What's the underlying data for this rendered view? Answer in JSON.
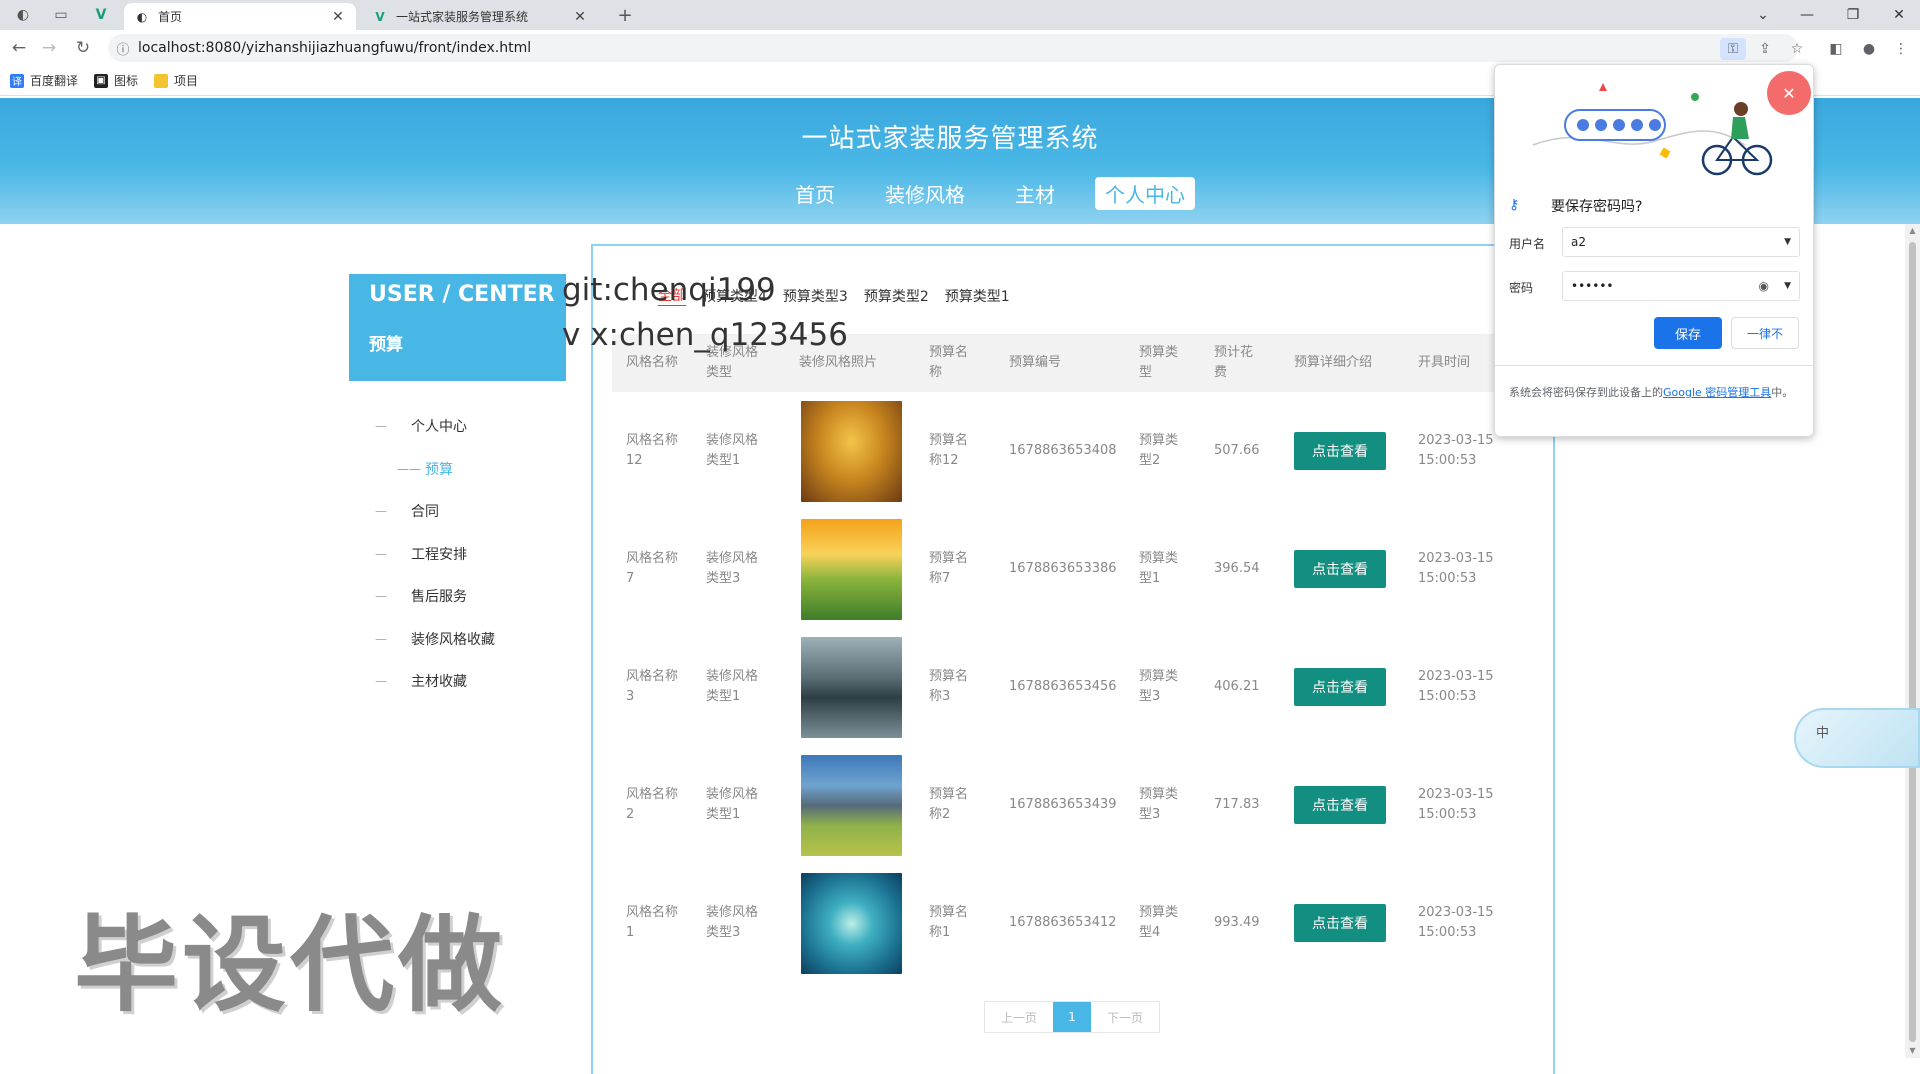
{
  "browser": {
    "tabs": [
      {
        "title": "首页",
        "active": true
      },
      {
        "title": "一站式家装服务管理系统",
        "active": false
      }
    ],
    "new_tab": "+",
    "url": "localhost:8080/yizhanshijiazhuangfuwu/front/index.html",
    "bookmarks": [
      "百度翻译",
      "图标",
      "项目"
    ]
  },
  "site": {
    "title": "一站式家装服务管理系统",
    "nav": [
      "首页",
      "装修风格",
      "主材",
      "个人中心"
    ],
    "nav_active": "个人中心"
  },
  "sidebar": {
    "header_title": "USER / CENTER",
    "header_sub": "预算",
    "items": [
      "个人中心",
      "预算",
      "合同",
      "工程安排",
      "售后服务",
      "装修风格收藏",
      "主材收藏"
    ],
    "active": "预算"
  },
  "filters": [
    "全部",
    "预算类型4",
    "预算类型3",
    "预算类型2",
    "预算类型1"
  ],
  "table": {
    "headers": [
      "风格名称",
      "装修风格类型",
      "装修风格照片",
      "预算名称",
      "预算编号",
      "预算类型",
      "预计花费",
      "预算详细介绍",
      "开具时间"
    ],
    "button_label": "点击查看",
    "rows": [
      {
        "style_name": "风格名称12",
        "style_type": "装修风格类型1",
        "photo": "autumn-forest",
        "budget_name": "预算名称12",
        "budget_no": "1678863653408",
        "budget_type": "预算类型2",
        "cost": "507.66",
        "date": "2023-03-15",
        "time": "15:00:53"
      },
      {
        "style_name": "风格名称7",
        "style_type": "装修风格类型3",
        "photo": "sunset-flowers",
        "budget_name": "预算名称7",
        "budget_no": "1678863653386",
        "budget_type": "预算类型1",
        "cost": "396.54",
        "date": "2023-03-15",
        "time": "15:00:53"
      },
      {
        "style_name": "风格名称3",
        "style_type": "装修风格类型1",
        "photo": "mountain-lake",
        "budget_name": "预算名称3",
        "budget_no": "1678863653456",
        "budget_type": "预算类型3",
        "cost": "406.21",
        "date": "2023-03-15",
        "time": "15:00:53"
      },
      {
        "style_name": "风格名称2",
        "style_type": "装修风格类型1",
        "photo": "mountain-meadow",
        "budget_name": "预算名称2",
        "budget_no": "1678863653439",
        "budget_type": "预算类型3",
        "cost": "717.83",
        "date": "2023-03-15",
        "time": "15:00:53"
      },
      {
        "style_name": "风格名称1",
        "style_type": "装修风格类型3",
        "photo": "heart-island",
        "budget_name": "预算名称1",
        "budget_no": "1678863653412",
        "budget_type": "预算类型4",
        "cost": "993.49",
        "date": "2023-03-15",
        "time": "15:00:53"
      }
    ]
  },
  "pager": {
    "prev": "上一页",
    "current": "1",
    "next": "下一页"
  },
  "overlays": {
    "git": "git:chenqi199",
    "vx": "v x:chen_q123456",
    "big": "毕设代做"
  },
  "float_widget": {
    "label": "中"
  },
  "password_popup": {
    "heading": "要保存密码吗?",
    "username_label": "用户名",
    "username": "a2",
    "password_label": "密码",
    "password": "••••••",
    "save": "保存",
    "never": "一律不",
    "footer_prefix": "系统会将密码保存到此设备上的",
    "footer_link": "Google 密码管理工具",
    "footer_suffix": "中。"
  },
  "colors": {
    "primary": "#49b7e6",
    "button": "#138f81",
    "filter_active": "#e53935",
    "chrome_blue": "#1a73e8"
  }
}
